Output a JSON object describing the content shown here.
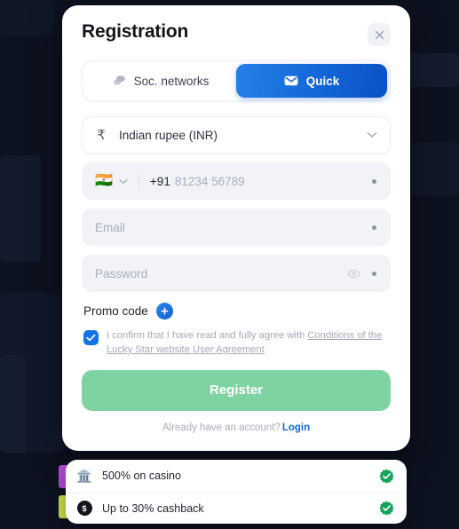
{
  "modal": {
    "title": "Registration",
    "close_icon": "close-icon",
    "tabs": [
      {
        "label": "Soc. networks",
        "icon": "chat-bubble-icon",
        "active": false
      },
      {
        "label": "Quick",
        "icon": "envelope-icon",
        "active": true
      }
    ],
    "currency": {
      "symbol": "₹",
      "value": "Indian rupee (INR)",
      "chevron_icon": "chevron-down-icon"
    },
    "phone": {
      "flag": "🇮🇳",
      "country_chevron_icon": "chevron-down-icon",
      "dial_code": "+91",
      "placeholder": "81234 56789"
    },
    "email": {
      "placeholder": "Email"
    },
    "password": {
      "placeholder": "Password",
      "toggle_icon": "eye-icon"
    },
    "promo": {
      "label": "Promo code",
      "add_icon": "plus-icon"
    },
    "consent": {
      "checked": true,
      "text_plain": "I confirm that I have read and fully agree with ",
      "text_link": "Conditions of the Lucky Star website User Agreement"
    },
    "submit_label": "Register",
    "login_prompt": "Already have an account?",
    "login_label": "Login"
  },
  "bonus": {
    "rows": [
      {
        "label": "500% on casino",
        "icon": "casino-bank-icon",
        "status_icon": "green-check-badge",
        "accent": "#b44ad6"
      },
      {
        "label": "Up to 30% cashback",
        "icon": "coin-dollar-icon",
        "status_icon": "green-check-badge",
        "accent": "#c8e04a"
      }
    ]
  },
  "colors": {
    "page_background": "#0d1220",
    "accent_blue": "#1268dc",
    "register_green": "#7fd3a3",
    "check_green": "#16a45d"
  }
}
